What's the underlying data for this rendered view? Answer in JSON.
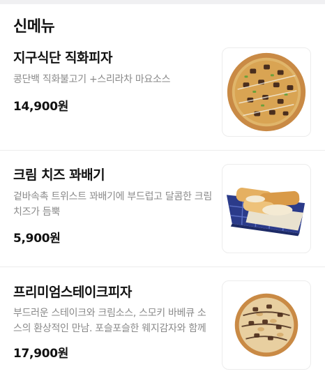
{
  "section": {
    "title": "신메뉴"
  },
  "items": [
    {
      "name": "지구식단 직화피자",
      "description": "콩단백 직화불고기 +스리라차 마요소스",
      "price": "14,900원",
      "image_icon": "pizza-image"
    },
    {
      "name": "크림 치즈 꽈배기",
      "description": "겉바속촉 트위스트 꽈배기에 부드럽고 달콤한 크림치즈가 듬뿍",
      "price": "5,900원",
      "image_icon": "bread-basket-image"
    },
    {
      "name": "프리미엄스테이크피자",
      "description": "부드러운 스테이크와 크림소스, 스모키 바베큐 소스의 환상적인 만남. 포슬포슬한 웨지감자와 함께",
      "price": "17,900원",
      "image_icon": "pizza-image"
    }
  ]
}
